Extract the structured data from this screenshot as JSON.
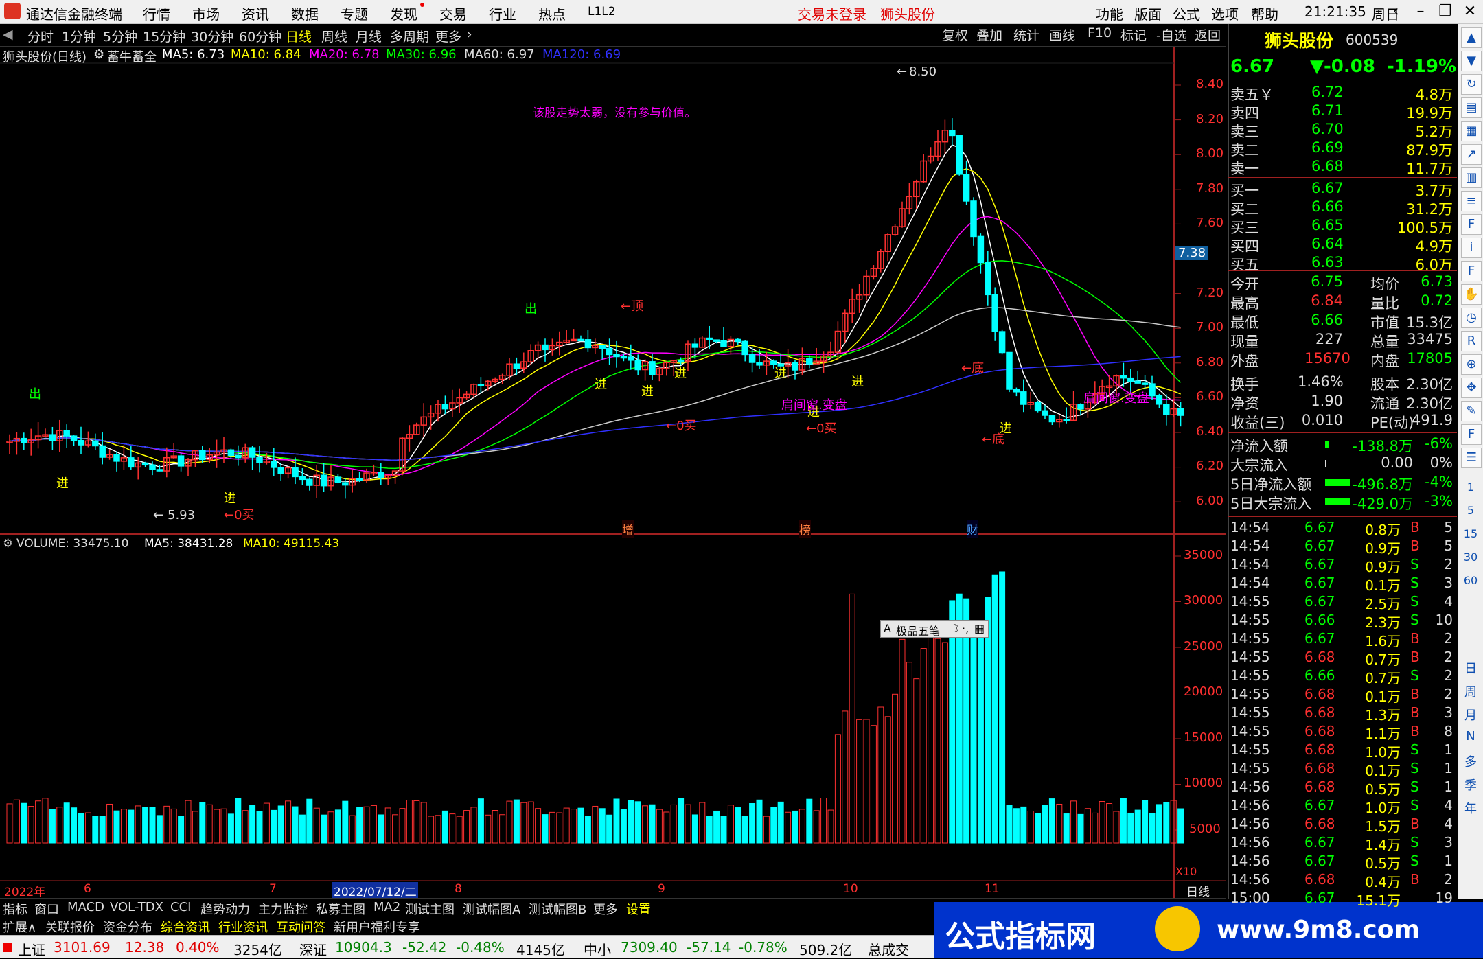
{
  "titlebar": {
    "app_name": "通达信金融终端",
    "menu": [
      "行情",
      "市场",
      "资讯",
      "数据",
      "专题",
      "发现",
      "交易",
      "行业",
      "热点",
      "L1L2"
    ],
    "alerts": [
      "交易未登录",
      "狮头股份"
    ],
    "right_menu": [
      "功能",
      "版面",
      "公式",
      "选项",
      "帮助"
    ],
    "time": "21:21:35",
    "weekday": "周日"
  },
  "periods": [
    "分时",
    "1分钟",
    "5分钟",
    "15分钟",
    "30分钟",
    "60分钟",
    "日线",
    "周线",
    "月线",
    "多周期",
    "更多"
  ],
  "active_period": "日线",
  "tools": [
    "复权",
    "叠加",
    "统计",
    "画线",
    "F10",
    "标记",
    "-自选",
    "返回"
  ],
  "chart_header": {
    "name": "狮头股份(日线)",
    "formula": "蓄牛蓄全",
    "ma5": "MA5: 6.73",
    "ma10": "MA10: 6.84",
    "ma20": "MA20: 6.78",
    "ma30": "MA30: 6.96",
    "ma60": "MA60: 6.97",
    "ma120": "MA120: 6.69"
  },
  "annotations": {
    "note": "该股走势太弱，没有参与价值。",
    "high": "8.50",
    "low": "5.93",
    "price_tag": "7.38",
    "events": [
      "增",
      "榜",
      "财"
    ],
    "signals": {
      "out": "出",
      "in": "进",
      "top": "←顶",
      "buy": "←0买",
      "bottom": "←底",
      "jian": "肩间窗.变盘"
    }
  },
  "price_axis": [
    "8.40",
    "8.20",
    "8.00",
    "7.80",
    "7.60",
    "7.40",
    "7.20",
    "7.00",
    "6.80",
    "6.60",
    "6.40",
    "6.20",
    "6.00"
  ],
  "volume_header": {
    "label": "VOLUME: 33475.10",
    "ma5": "MA5: 38431.28",
    "ma10": "MA10: 49115.43"
  },
  "volume_axis": [
    "35000",
    "30000",
    "25000",
    "20000",
    "15000",
    "10000",
    "5000"
  ],
  "volume_unit": "X10",
  "floating_tool": "极品五笔",
  "date_axis": [
    "2022年",
    "6",
    "7",
    "2022/07/12/二",
    "8",
    "9",
    "10",
    "11"
  ],
  "date_axis_right": "日线",
  "quote": {
    "name": "狮头股份",
    "code": "600539",
    "price": "6.67",
    "change": "▼-0.08",
    "pct": "-1.19%",
    "asks": [
      {
        "label": "卖五￥",
        "price": "6.72",
        "vol": "4.8万"
      },
      {
        "label": "卖四",
        "price": "6.71",
        "vol": "19.9万"
      },
      {
        "label": "卖三",
        "price": "6.70",
        "vol": "5.2万"
      },
      {
        "label": "卖二",
        "price": "6.69",
        "vol": "87.9万"
      },
      {
        "label": "卖一",
        "price": "6.68",
        "vol": "11.7万"
      }
    ],
    "bids": [
      {
        "label": "买一",
        "price": "6.67",
        "vol": "3.7万"
      },
      {
        "label": "买二",
        "price": "6.66",
        "vol": "31.2万"
      },
      {
        "label": "买三",
        "price": "6.65",
        "vol": "100.5万"
      },
      {
        "label": "买四",
        "price": "6.64",
        "vol": "4.9万"
      },
      {
        "label": "买五",
        "price": "6.63",
        "vol": "6.0万"
      }
    ],
    "stats": [
      {
        "k1": "今开",
        "v1": "6.75",
        "k2": "均价",
        "v2": "6.73"
      },
      {
        "k1": "最高",
        "v1": "6.84",
        "k2": "量比",
        "v2": "0.72"
      },
      {
        "k1": "最低",
        "v1": "6.66",
        "k2": "市值",
        "v2": "15.3亿"
      },
      {
        "k1": "现量",
        "v1": "227",
        "k2": "总量",
        "v2": "33475"
      },
      {
        "k1": "外盘",
        "v1": "15670",
        "k2": "内盘",
        "v2": "17805"
      }
    ],
    "fund": [
      {
        "k1": "换手",
        "v1": "1.46%",
        "k2": "股本",
        "v2": "2.30亿"
      },
      {
        "k1": "净资",
        "v1": "1.90",
        "k2": "流通",
        "v2": "2.30亿"
      },
      {
        "k1": "收益(三)",
        "v1": "0.010",
        "k2": "PE(动)",
        "v2": "491.9"
      }
    ],
    "flows": [
      {
        "k": "净流入额",
        "v": "-138.8万",
        "p": "-6%"
      },
      {
        "k": "大宗流入",
        "v": "0.00",
        "p": "0%"
      },
      {
        "k": "5日净流入额",
        "v": "-496.8万",
        "p": "-4%"
      },
      {
        "k": "5日大宗流入",
        "v": "-429.0万",
        "p": "-3%"
      }
    ],
    "ticks": [
      [
        "14:54",
        "6.67",
        "0.8万",
        "B",
        "5"
      ],
      [
        "14:54",
        "6.67",
        "0.9万",
        "B",
        "5"
      ],
      [
        "14:54",
        "6.67",
        "0.9万",
        "S",
        "2"
      ],
      [
        "14:54",
        "6.67",
        "0.1万",
        "S",
        "3"
      ],
      [
        "14:55",
        "6.67",
        "2.5万",
        "S",
        "4"
      ],
      [
        "14:55",
        "6.66",
        "2.3万",
        "S",
        "10"
      ],
      [
        "14:55",
        "6.67",
        "1.6万",
        "B",
        "2"
      ],
      [
        "14:55",
        "6.68",
        "0.7万",
        "B",
        "2"
      ],
      [
        "14:55",
        "6.66",
        "0.7万",
        "S",
        "2"
      ],
      [
        "14:55",
        "6.68",
        "0.1万",
        "B",
        "2"
      ],
      [
        "14:55",
        "6.68",
        "1.3万",
        "B",
        "3"
      ],
      [
        "14:55",
        "6.68",
        "1.1万",
        "B",
        "8"
      ],
      [
        "14:55",
        "6.68",
        "1.0万",
        "S",
        "1"
      ],
      [
        "14:55",
        "6.68",
        "0.1万",
        "S",
        "1"
      ],
      [
        "14:56",
        "6.68",
        "0.5万",
        "S",
        "1"
      ],
      [
        "14:56",
        "6.67",
        "1.0万",
        "S",
        "4"
      ],
      [
        "14:56",
        "6.68",
        "1.5万",
        "B",
        "4"
      ],
      [
        "14:56",
        "6.67",
        "1.4万",
        "S",
        "3"
      ],
      [
        "14:56",
        "6.67",
        "0.5万",
        "S",
        "1"
      ],
      [
        "14:56",
        "6.68",
        "0.4万",
        "B",
        "2"
      ],
      [
        "15:00",
        "6.67",
        "15.1万",
        "",
        "19"
      ]
    ]
  },
  "sidebar_labels": [
    "日",
    "周",
    "月",
    "N",
    "多",
    "季",
    "年"
  ],
  "sidebar_numbers": [
    "1",
    "5",
    "15",
    "30",
    "60"
  ],
  "tabs_row1": [
    "指标",
    "窗口",
    "MACD",
    "VOL-TDX",
    "CCI",
    "趋势动力",
    "主力监控",
    "私募主图",
    "MA2",
    "测试主图",
    "测试幅图A",
    "测试幅图B",
    "更多",
    "设置"
  ],
  "tabs_row2": [
    "扩展∧",
    "关联报价",
    "资金分布",
    "综合资讯",
    "行业资讯",
    "互动问答",
    "新用户福利专享"
  ],
  "statusbar": [
    {
      "name": "上证",
      "val": "3101.69",
      "chg": "12.38",
      "pct": "0.40%",
      "amt": "3254亿"
    },
    {
      "name": "深证",
      "val": "10904.3",
      "chg": "-52.42",
      "pct": "-0.48%",
      "amt": "4145亿"
    },
    {
      "name": "中小",
      "val": "7309.40",
      "chg": "-57.14",
      "pct": "-0.78%",
      "amt": "509.2亿"
    }
  ],
  "status_extra": "总成交",
  "banner": {
    "title": "公式指标网",
    "url": "www.9m8.com"
  },
  "colors": {
    "up": "#ff3030",
    "down": "#00ffff",
    "ma5": "#ffffff",
    "ma10": "#ffff00",
    "ma20": "#ff00ff",
    "ma30": "#00ff00",
    "ma60": "#cccccc",
    "ma120": "#3030ff"
  }
}
